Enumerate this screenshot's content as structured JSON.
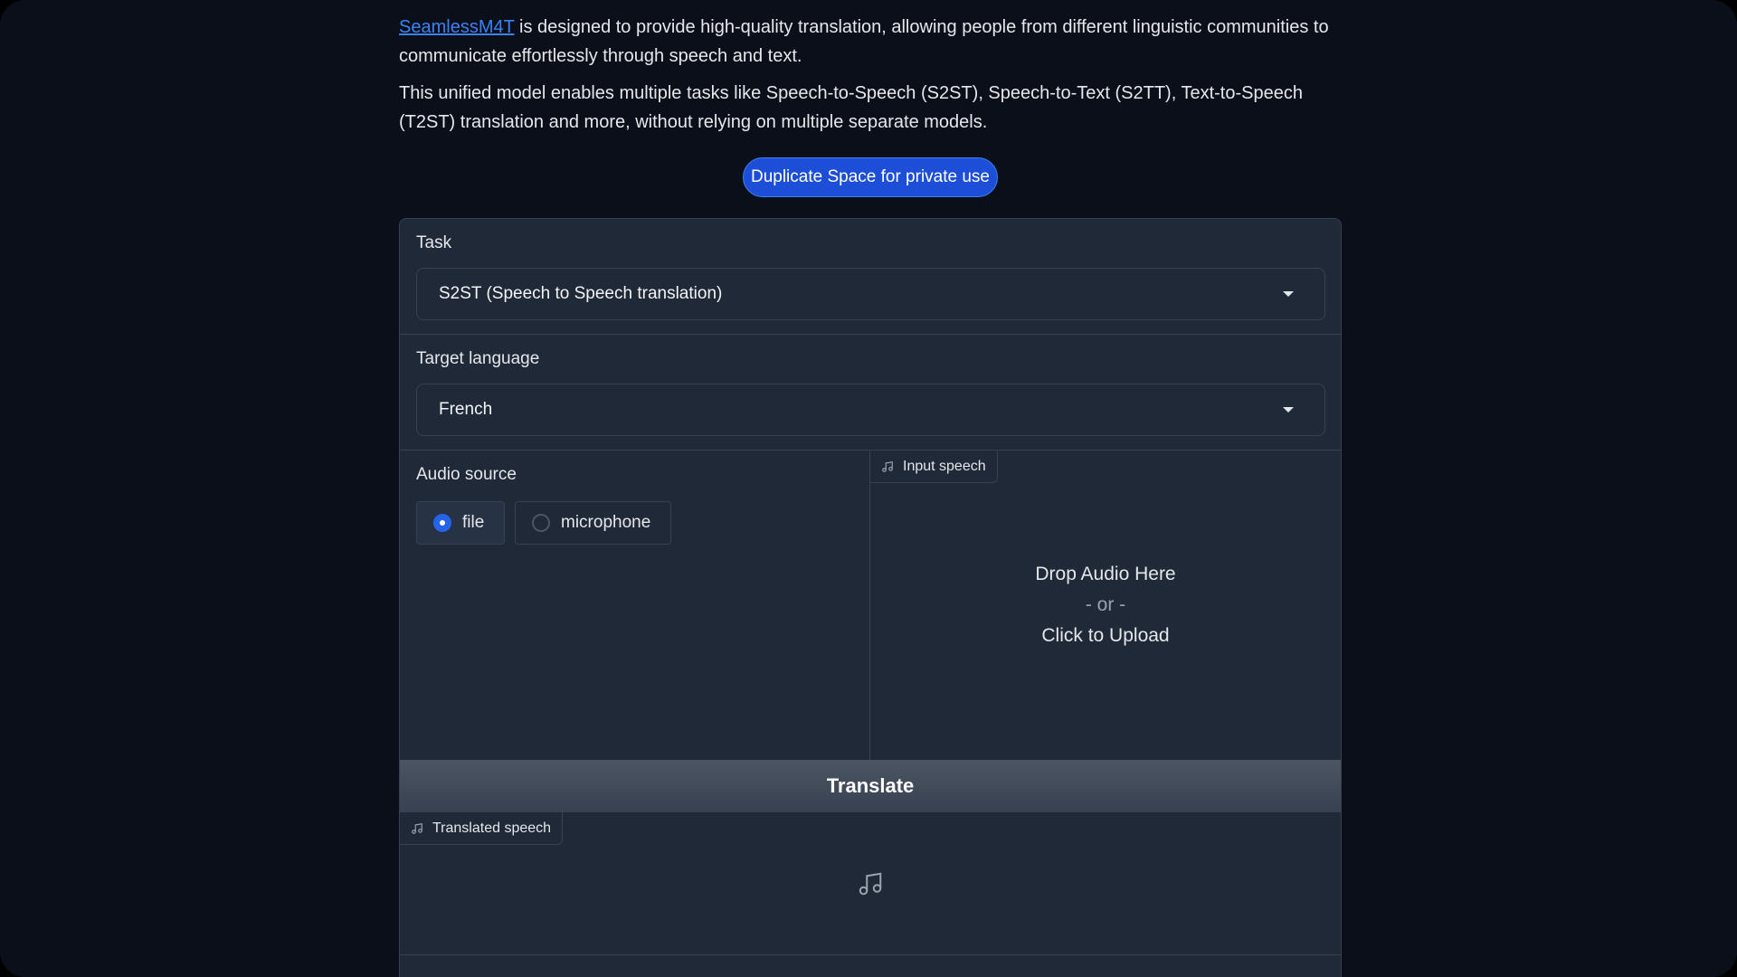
{
  "intro": {
    "link_text": "SeamlessM4T",
    "p1_rest": " is designed to provide high-quality translation, allowing people from different linguistic communities to communicate effortlessly through speech and text.",
    "p2": "This unified model enables multiple tasks like Speech-to-Speech (S2ST), Speech-to-Text (S2TT), Text-to-Speech (T2ST) translation and more, without relying on multiple separate models."
  },
  "duplicate_button": "Duplicate Space for private use",
  "task": {
    "label": "Task",
    "selected": "S2ST (Speech to Speech translation)"
  },
  "target_language": {
    "label": "Target language",
    "selected": "French"
  },
  "audio_source": {
    "label": "Audio source",
    "options": [
      "file",
      "microphone"
    ],
    "selected": "file"
  },
  "input_speech": {
    "tag": "Input speech",
    "drop_line1": "Drop Audio Here",
    "drop_line2": "- or -",
    "drop_line3": "Click to Upload"
  },
  "translate_button": "Translate",
  "translated_speech": {
    "tag": "Translated speech"
  },
  "colors": {
    "background": "#0b0f19",
    "panel": "#1f2937",
    "accent": "#2563eb",
    "link": "#3b82f6"
  }
}
